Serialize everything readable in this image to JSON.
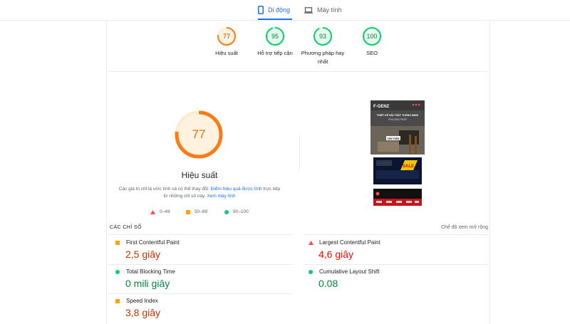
{
  "tabs": {
    "mobile": "Di động",
    "desktop": "Máy tính"
  },
  "summary": [
    {
      "score": "77",
      "label": "Hiệu suất",
      "color": "#fa7b17"
    },
    {
      "score": "95",
      "label": "Hỗ trợ tiếp cận",
      "color": "#0cce6b"
    },
    {
      "score": "93",
      "label": "Phương pháp hay nhất",
      "color": "#0cce6b"
    },
    {
      "score": "100",
      "label": "SEO",
      "color": "#0cce6b"
    }
  ],
  "performance": {
    "score": "77",
    "fraction": 0.77,
    "title": "Hiệu suất",
    "desc_prefix": "Các giá trị chỉ là ước tính và có thể thay đổi.",
    "desc_link1": "Điểm hiệu quả được tính",
    "desc_middle": "trực tiếp từ những chỉ số này.",
    "desc_link2": "Xem máy tính",
    "legend": {
      "fail": "0–49",
      "average": "50–89",
      "pass": "90–100"
    }
  },
  "screenshot": {
    "brand": "F·GENZ",
    "headline": "THIẾT KẾ NỘI THẤT THÔNG MINH",
    "subline": "PHƯƠNG PHÁP",
    "cta": "XEM THÊM",
    "banner": "SALE"
  },
  "metrics": {
    "section_title": "CÁC CHỈ SỐ",
    "expand_label": "Chế độ xem mở rộng",
    "items": [
      {
        "name": "First Contentful Paint",
        "value": "2,5 giây",
        "status": "average"
      },
      {
        "name": "Largest Contentful Paint",
        "value": "4,6 giây",
        "status": "fail"
      },
      {
        "name": "Total Blocking Time",
        "value": "0 mili giây",
        "status": "pass"
      },
      {
        "name": "Cumulative Layout Shift",
        "value": "0.08",
        "status": "pass"
      },
      {
        "name": "Speed Index",
        "value": "3,8 giây",
        "status": "average"
      }
    ]
  },
  "colors": {
    "pass": "#0cce6b",
    "average": "#ffa400",
    "fail": "#ff4e42",
    "pass_text": "#018642",
    "average_text": "#c33300",
    "fail_text": "#eb0f00",
    "link": "#1a73e8"
  }
}
